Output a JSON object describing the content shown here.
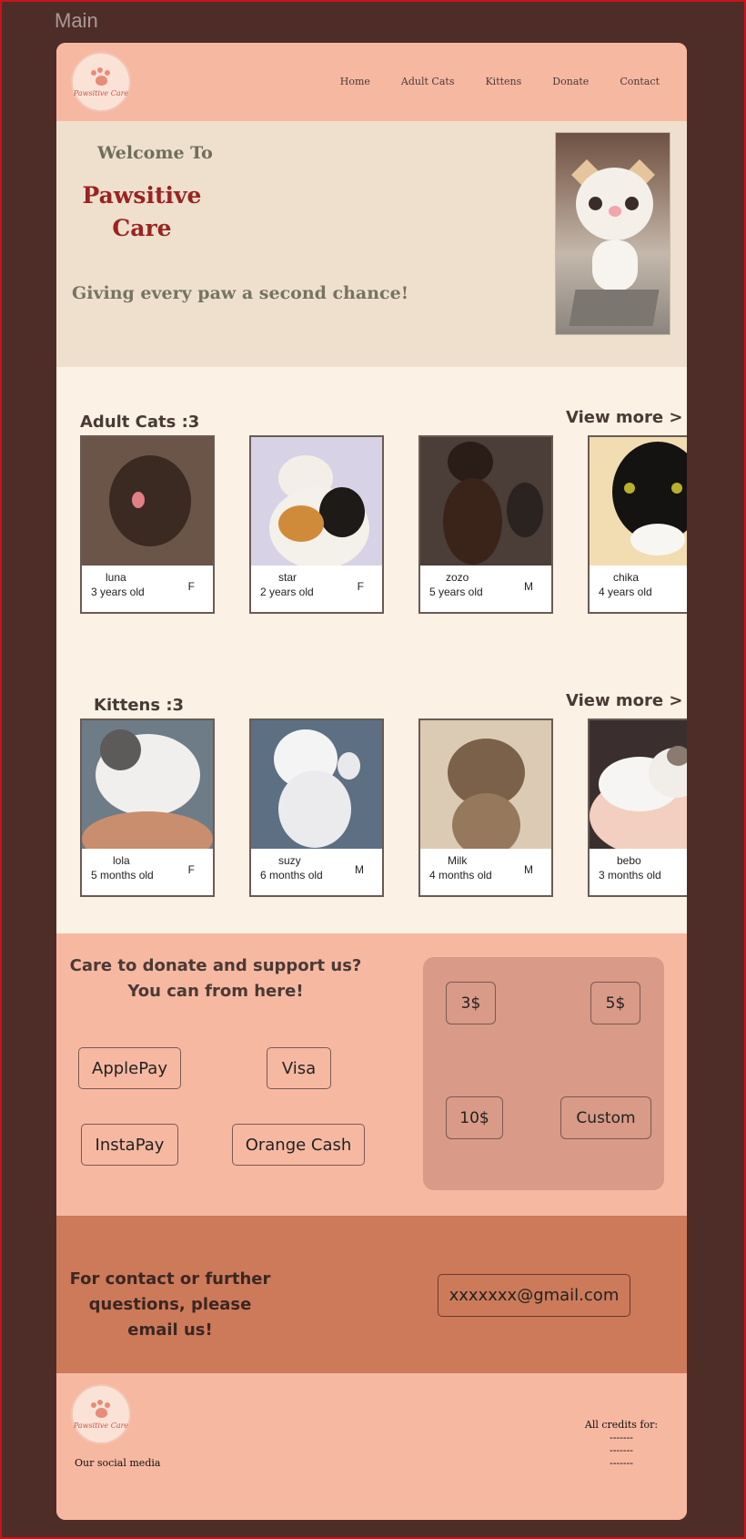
{
  "frame_label": "Main",
  "header": {
    "logo_text": "Pawsitive Care",
    "nav": [
      "Home",
      "Adult Cats",
      "Kittens",
      "Donate",
      "Contact"
    ]
  },
  "hero": {
    "welcome": "Welcome To",
    "brand_line1": "Pawsitive",
    "brand_line2": "Care",
    "tagline": "Giving every paw a second chance!"
  },
  "adult_cats": {
    "title": "Adult Cats :3",
    "view_more": "View more >",
    "cards": [
      {
        "name": "luna",
        "age": "3 years old",
        "sex": "F"
      },
      {
        "name": "star",
        "age": "2 years old",
        "sex": "F"
      },
      {
        "name": "zozo",
        "age": "5 years old",
        "sex": "M"
      },
      {
        "name": "chika",
        "age": "4 years old",
        "sex": ""
      }
    ]
  },
  "kittens": {
    "title": "Kittens :3",
    "view_more": "View more >",
    "cards": [
      {
        "name": "lola",
        "age": "5 months old",
        "sex": "F"
      },
      {
        "name": "suzy",
        "age": "6 months old",
        "sex": "M"
      },
      {
        "name": "Milk",
        "age": "4 months old",
        "sex": "M"
      },
      {
        "name": "bebo",
        "age": "3 months  old",
        "sex": ""
      }
    ]
  },
  "donate": {
    "line1": "Care to donate and support us?",
    "line2": "You can from here!",
    "methods": [
      "ApplePay",
      "Visa",
      "InstaPay",
      "Orange Cash"
    ],
    "amounts": [
      "3$",
      "5$",
      "10$",
      "Custom"
    ]
  },
  "contact": {
    "line1": "For contact or further",
    "line2": "questions, please email us!",
    "email": "xxxxxxx@gmail.com"
  },
  "footer": {
    "logo_text": "Pawsitive Care",
    "social": "Our social media",
    "credits_title": "All credits for:",
    "credits_lines": [
      "-------",
      "-------",
      "-------"
    ]
  },
  "colors": {
    "frame_bg": "#4e2d28",
    "page_bg": "#f7b8a2",
    "hero_bg": "#efe0ce",
    "cream_bg": "#fbf1e4",
    "contact_bg": "#cd7a5b",
    "brand_red": "#9b2321"
  }
}
